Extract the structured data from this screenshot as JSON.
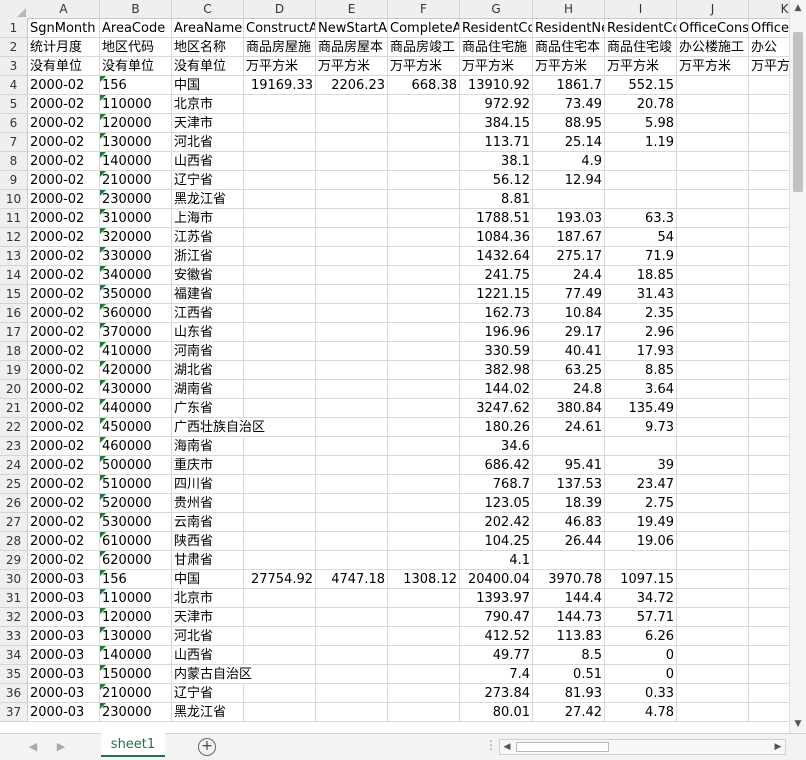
{
  "spreadsheet": {
    "column_letters": [
      "A",
      "B",
      "C",
      "D",
      "E",
      "F",
      "G",
      "H",
      "I",
      "J",
      "K"
    ],
    "rows": [
      {
        "n": "1",
        "a": "SgnMonth",
        "b": "AreaCode",
        "c": "AreaName",
        "d": "ConstructA",
        "e": "NewStartA",
        "f": "CompleteA",
        "g": "ResidentCo",
        "h": "ResidentNe",
        "i": "ResidentCo",
        "j": "OfficeCons",
        "k": "Office"
      },
      {
        "n": "2",
        "a": "统计月度",
        "b": "地区代码",
        "c": "地区名称",
        "d": "商品房屋施",
        "e": "商品房屋本",
        "f": "商品房竣工",
        "g": "商品住宅施",
        "h": "商品住宅本",
        "i": "商品住宅竣",
        "j": "办公楼施工",
        "k": "办公"
      },
      {
        "n": "3",
        "a": "没有单位",
        "b": "没有单位",
        "c": "没有单位",
        "d": "万平方米",
        "e": "万平方米",
        "f": "万平方米",
        "g": "万平方米",
        "h": "万平方米",
        "i": "万平方米",
        "j": "万平方米",
        "k": "万平方"
      },
      {
        "n": "4",
        "a": "2000-02",
        "b": "156",
        "c": "中国",
        "d": "19169.33",
        "e": "2206.23",
        "f": "668.38",
        "g": "13910.92",
        "h": "1861.7",
        "i": "552.15",
        "j": "",
        "k": ""
      },
      {
        "n": "5",
        "a": "2000-02",
        "b": "110000",
        "c": "北京市",
        "d": "",
        "e": "",
        "f": "",
        "g": "972.92",
        "h": "73.49",
        "i": "20.78",
        "j": "",
        "k": ""
      },
      {
        "n": "6",
        "a": "2000-02",
        "b": "120000",
        "c": "天津市",
        "d": "",
        "e": "",
        "f": "",
        "g": "384.15",
        "h": "88.95",
        "i": "5.98",
        "j": "",
        "k": ""
      },
      {
        "n": "7",
        "a": "2000-02",
        "b": "130000",
        "c": "河北省",
        "d": "",
        "e": "",
        "f": "",
        "g": "113.71",
        "h": "25.14",
        "i": "1.19",
        "j": "",
        "k": ""
      },
      {
        "n": "8",
        "a": "2000-02",
        "b": "140000",
        "c": "山西省",
        "d": "",
        "e": "",
        "f": "",
        "g": "38.1",
        "h": "4.9",
        "i": "",
        "j": "",
        "k": ""
      },
      {
        "n": "9",
        "a": "2000-02",
        "b": "210000",
        "c": "辽宁省",
        "d": "",
        "e": "",
        "f": "",
        "g": "56.12",
        "h": "12.94",
        "i": "",
        "j": "",
        "k": ""
      },
      {
        "n": "10",
        "a": "2000-02",
        "b": "230000",
        "c": "黑龙江省",
        "d": "",
        "e": "",
        "f": "",
        "g": "8.81",
        "h": "",
        "i": "",
        "j": "",
        "k": ""
      },
      {
        "n": "11",
        "a": "2000-02",
        "b": "310000",
        "c": "上海市",
        "d": "",
        "e": "",
        "f": "",
        "g": "1788.51",
        "h": "193.03",
        "i": "63.3",
        "j": "",
        "k": ""
      },
      {
        "n": "12",
        "a": "2000-02",
        "b": "320000",
        "c": "江苏省",
        "d": "",
        "e": "",
        "f": "",
        "g": "1084.36",
        "h": "187.67",
        "i": "54",
        "j": "",
        "k": ""
      },
      {
        "n": "13",
        "a": "2000-02",
        "b": "330000",
        "c": "浙江省",
        "d": "",
        "e": "",
        "f": "",
        "g": "1432.64",
        "h": "275.17",
        "i": "71.9",
        "j": "",
        "k": ""
      },
      {
        "n": "14",
        "a": "2000-02",
        "b": "340000",
        "c": "安徽省",
        "d": "",
        "e": "",
        "f": "",
        "g": "241.75",
        "h": "24.4",
        "i": "18.85",
        "j": "",
        "k": ""
      },
      {
        "n": "15",
        "a": "2000-02",
        "b": "350000",
        "c": "福建省",
        "d": "",
        "e": "",
        "f": "",
        "g": "1221.15",
        "h": "77.49",
        "i": "31.43",
        "j": "",
        "k": ""
      },
      {
        "n": "16",
        "a": "2000-02",
        "b": "360000",
        "c": "江西省",
        "d": "",
        "e": "",
        "f": "",
        "g": "162.73",
        "h": "10.84",
        "i": "2.35",
        "j": "",
        "k": ""
      },
      {
        "n": "17",
        "a": "2000-02",
        "b": "370000",
        "c": "山东省",
        "d": "",
        "e": "",
        "f": "",
        "g": "196.96",
        "h": "29.17",
        "i": "2.96",
        "j": "",
        "k": ""
      },
      {
        "n": "18",
        "a": "2000-02",
        "b": "410000",
        "c": "河南省",
        "d": "",
        "e": "",
        "f": "",
        "g": "330.59",
        "h": "40.41",
        "i": "17.93",
        "j": "",
        "k": ""
      },
      {
        "n": "19",
        "a": "2000-02",
        "b": "420000",
        "c": "湖北省",
        "d": "",
        "e": "",
        "f": "",
        "g": "382.98",
        "h": "63.25",
        "i": "8.85",
        "j": "",
        "k": ""
      },
      {
        "n": "20",
        "a": "2000-02",
        "b": "430000",
        "c": "湖南省",
        "d": "",
        "e": "",
        "f": "",
        "g": "144.02",
        "h": "24.8",
        "i": "3.64",
        "j": "",
        "k": ""
      },
      {
        "n": "21",
        "a": "2000-02",
        "b": "440000",
        "c": "广东省",
        "d": "",
        "e": "",
        "f": "",
        "g": "3247.62",
        "h": "380.84",
        "i": "135.49",
        "j": "",
        "k": ""
      },
      {
        "n": "22",
        "a": "2000-02",
        "b": "450000",
        "c": "广西壮族自治区",
        "d": "",
        "e": "",
        "f": "",
        "g": "180.26",
        "h": "24.61",
        "i": "9.73",
        "j": "",
        "k": ""
      },
      {
        "n": "23",
        "a": "2000-02",
        "b": "460000",
        "c": "海南省",
        "d": "",
        "e": "",
        "f": "",
        "g": "34.6",
        "h": "",
        "i": "",
        "j": "",
        "k": ""
      },
      {
        "n": "24",
        "a": "2000-02",
        "b": "500000",
        "c": "重庆市",
        "d": "",
        "e": "",
        "f": "",
        "g": "686.42",
        "h": "95.41",
        "i": "39",
        "j": "",
        "k": ""
      },
      {
        "n": "25",
        "a": "2000-02",
        "b": "510000",
        "c": "四川省",
        "d": "",
        "e": "",
        "f": "",
        "g": "768.7",
        "h": "137.53",
        "i": "23.47",
        "j": "",
        "k": ""
      },
      {
        "n": "26",
        "a": "2000-02",
        "b": "520000",
        "c": "贵州省",
        "d": "",
        "e": "",
        "f": "",
        "g": "123.05",
        "h": "18.39",
        "i": "2.75",
        "j": "",
        "k": ""
      },
      {
        "n": "27",
        "a": "2000-02",
        "b": "530000",
        "c": "云南省",
        "d": "",
        "e": "",
        "f": "",
        "g": "202.42",
        "h": "46.83",
        "i": "19.49",
        "j": "",
        "k": ""
      },
      {
        "n": "28",
        "a": "2000-02",
        "b": "610000",
        "c": "陕西省",
        "d": "",
        "e": "",
        "f": "",
        "g": "104.25",
        "h": "26.44",
        "i": "19.06",
        "j": "",
        "k": ""
      },
      {
        "n": "29",
        "a": "2000-02",
        "b": "620000",
        "c": "甘肃省",
        "d": "",
        "e": "",
        "f": "",
        "g": "4.1",
        "h": "",
        "i": "",
        "j": "",
        "k": ""
      },
      {
        "n": "30",
        "a": "2000-03",
        "b": "156",
        "c": "中国",
        "d": "27754.92",
        "e": "4747.18",
        "f": "1308.12",
        "g": "20400.04",
        "h": "3970.78",
        "i": "1097.15",
        "j": "",
        "k": ""
      },
      {
        "n": "31",
        "a": "2000-03",
        "b": "110000",
        "c": "北京市",
        "d": "",
        "e": "",
        "f": "",
        "g": "1393.97",
        "h": "144.4",
        "i": "34.72",
        "j": "",
        "k": ""
      },
      {
        "n": "32",
        "a": "2000-03",
        "b": "120000",
        "c": "天津市",
        "d": "",
        "e": "",
        "f": "",
        "g": "790.47",
        "h": "144.73",
        "i": "57.71",
        "j": "",
        "k": ""
      },
      {
        "n": "33",
        "a": "2000-03",
        "b": "130000",
        "c": "河北省",
        "d": "",
        "e": "",
        "f": "",
        "g": "412.52",
        "h": "113.83",
        "i": "6.26",
        "j": "",
        "k": ""
      },
      {
        "n": "34",
        "a": "2000-03",
        "b": "140000",
        "c": "山西省",
        "d": "",
        "e": "",
        "f": "",
        "g": "49.77",
        "h": "8.5",
        "i": "0",
        "j": "",
        "k": ""
      },
      {
        "n": "35",
        "a": "2000-03",
        "b": "150000",
        "c": "内蒙古自治区",
        "d": "",
        "e": "",
        "f": "",
        "g": "7.4",
        "h": "0.51",
        "i": "0",
        "j": "",
        "k": ""
      },
      {
        "n": "36",
        "a": "2000-03",
        "b": "210000",
        "c": "辽宁省",
        "d": "",
        "e": "",
        "f": "",
        "g": "273.84",
        "h": "81.93",
        "i": "0.33",
        "j": "",
        "k": ""
      },
      {
        "n": "37",
        "a": "2000-03",
        "b": "230000",
        "c": "黑龙江省",
        "d": "",
        "e": "",
        "f": "",
        "g": "80.01",
        "h": "27.42",
        "i": "4.78",
        "j": "",
        "k": ""
      }
    ]
  },
  "sheet_tabs": [
    {
      "label": "sheet1",
      "active": true
    }
  ],
  "bottom_bar": {
    "add_sheet_label": "+",
    "nav_prev": "◀",
    "nav_next": "▶",
    "overflow_dots": "⋮"
  },
  "colors": {
    "accent": "#217346",
    "text_number_marker": "#1e7b34"
  }
}
